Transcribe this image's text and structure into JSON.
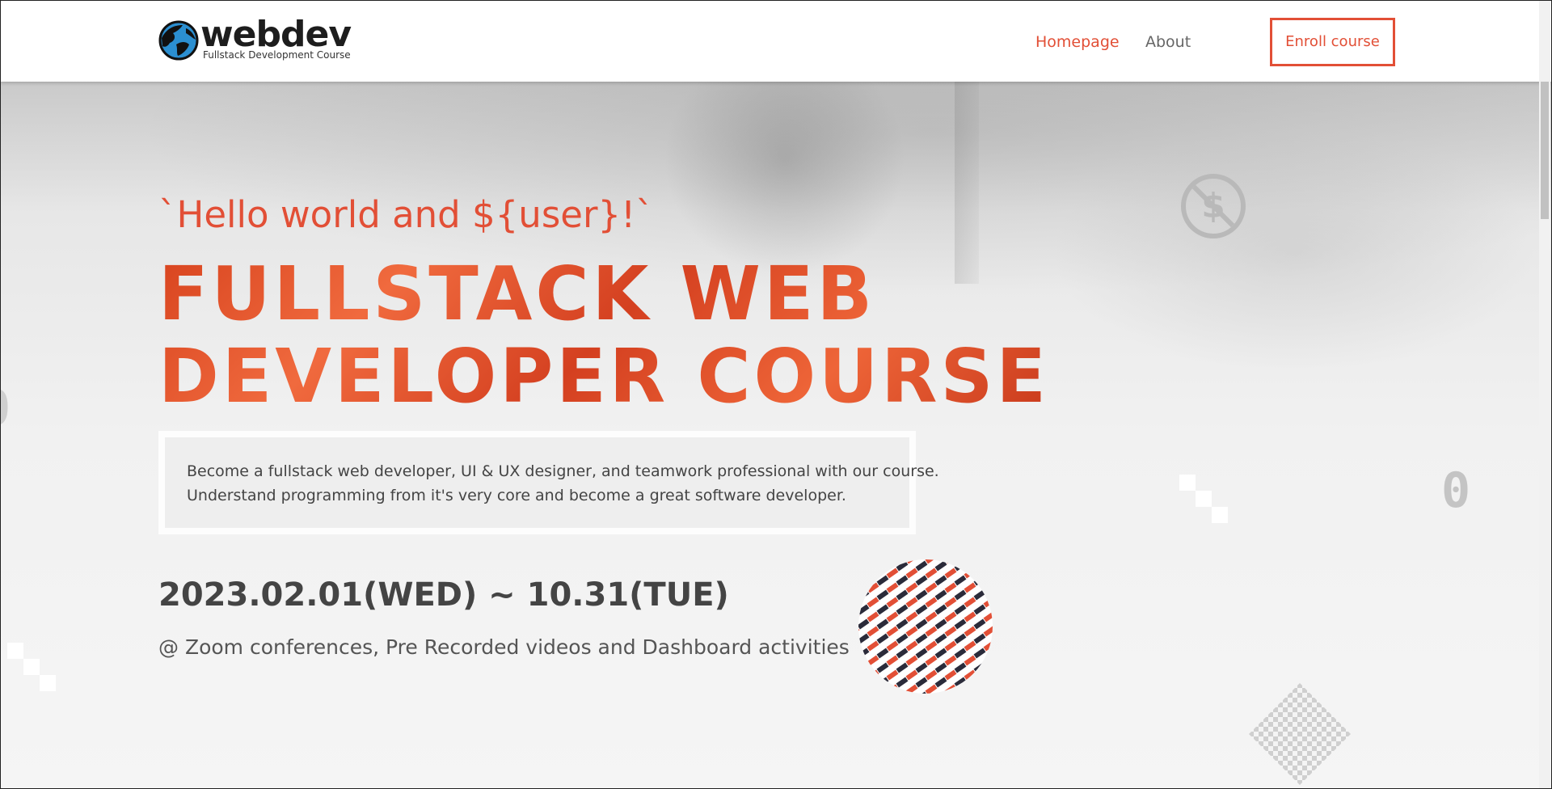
{
  "header": {
    "logo_word": "webdev",
    "logo_subtitle": "Fullstack Development Course",
    "nav": [
      {
        "label": "Homepage",
        "active": true
      },
      {
        "label": "About",
        "active": false
      }
    ],
    "enroll_label": "Enroll course"
  },
  "hero": {
    "greeting": "`Hello world and ${user}!`",
    "title_line1": "FULLSTACK WEB",
    "title_line2": "DEVELOPER COURSE",
    "description_line1": "Become a fullstack web developer, UI & UX designer, and teamwork professional with our course.",
    "description_line2": "Understand programming from it's very core and become a great software developer.",
    "dates": "2023.02.01(WED) ~ 10.31(TUE)",
    "location": "@ Zoom conferences, Pre Recorded videos and Dashboard activities"
  },
  "colors": {
    "accent": "#e24f36",
    "text_dark": "#444444",
    "nav_inactive": "#666666",
    "pattern_dark": "#2b2b3a"
  },
  "icons": [
    "globe-logo-icon",
    "no-dollar-icon",
    "zero-glyph-icon",
    "dot-pattern-circle",
    "diamond-grid-pattern"
  ]
}
